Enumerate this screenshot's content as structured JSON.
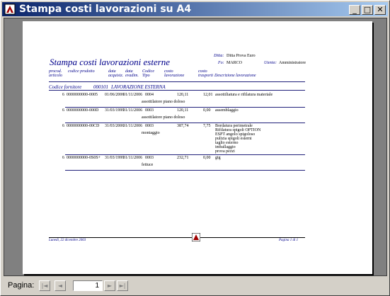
{
  "window": {
    "title": "Stampa costi lavorazioni su A4",
    "minimize_glyph": "_",
    "maximize_glyph": "□",
    "close_glyph": "✕"
  },
  "report": {
    "title": "Stampa costi lavorazioni esterne",
    "ditta_label": "Ditta:",
    "ditta_value": "Ditta Prova Euro",
    "fornitore_label": "Fo:",
    "fornitore_value": "MARCO",
    "utente_label": "Utente:",
    "utente_value": "Amministratore",
    "columns": {
      "c1": "procod.",
      "c1b": "articolo",
      "c2": "codice prodotto",
      "c3": "data",
      "c3b": "acquisiz.",
      "c4": "data",
      "c4b": "evadim.",
      "c5": "Codice",
      "c5b": "Tipo",
      "c6": "costo",
      "c6b": "lavorazione",
      "c7": "costo",
      "c7b": "trasporti",
      "c8": "Descrizione lavorazione"
    },
    "group": {
      "label": "Codice fornitore",
      "code": "000101",
      "name": "LAVORAZIONE ESTERNA"
    },
    "rows": [
      {
        "art": "6",
        "code": "0000000000-0005",
        "date1": "01/06/2006",
        "date2": "01/11/2006",
        "tipo": "0004",
        "costo": "120,11",
        "trasp": "12,01",
        "desc": "assottiliatura e rifilatura materiale",
        "sub": "assottilatore piano doloso",
        "extra": []
      },
      {
        "art": "6",
        "code": "0000000000-000D",
        "date1": "31/03/1999",
        "date2": "31/11/2006",
        "tipo": "0003",
        "costo": "120,11",
        "trasp": "0,00",
        "desc": "assemblaggio",
        "sub": "assottilatore piano doloso",
        "extra": []
      },
      {
        "art": "6",
        "code": "0000000000-00CD",
        "date1": "31/03/2006",
        "date2": "31/11/2006",
        "tipo": "0003",
        "costo": "387,74",
        "trasp": "7,75",
        "desc": "Bordatura perimetrale",
        "sub": "montaggio",
        "extra": [
          "Rifilatura spigoli OPTION",
          "ESPT angolo spigoloso",
          "pulizia spigoli esterni",
          "taglio esterno",
          "imballaggio",
          "prova pezzi"
        ]
      },
      {
        "art": "6",
        "code": "0000000000-0S0S+",
        "date1": "31/03/1999",
        "date2": "31/11/2006",
        "tipo": "0003",
        "costo": "232,71",
        "trasp": "0,00",
        "desc": "gig",
        "sub": "fettuce",
        "extra": []
      }
    ],
    "footer_left": "Lunedì, 22 dicembre 2003",
    "footer_right": "Pagina 1 di 1"
  },
  "status": {
    "pagina_label": "Pagina:",
    "page_value": "1",
    "first_glyph": "|◄",
    "prev_glyph": "◄",
    "next_glyph": "►",
    "last_glyph": "►|"
  }
}
